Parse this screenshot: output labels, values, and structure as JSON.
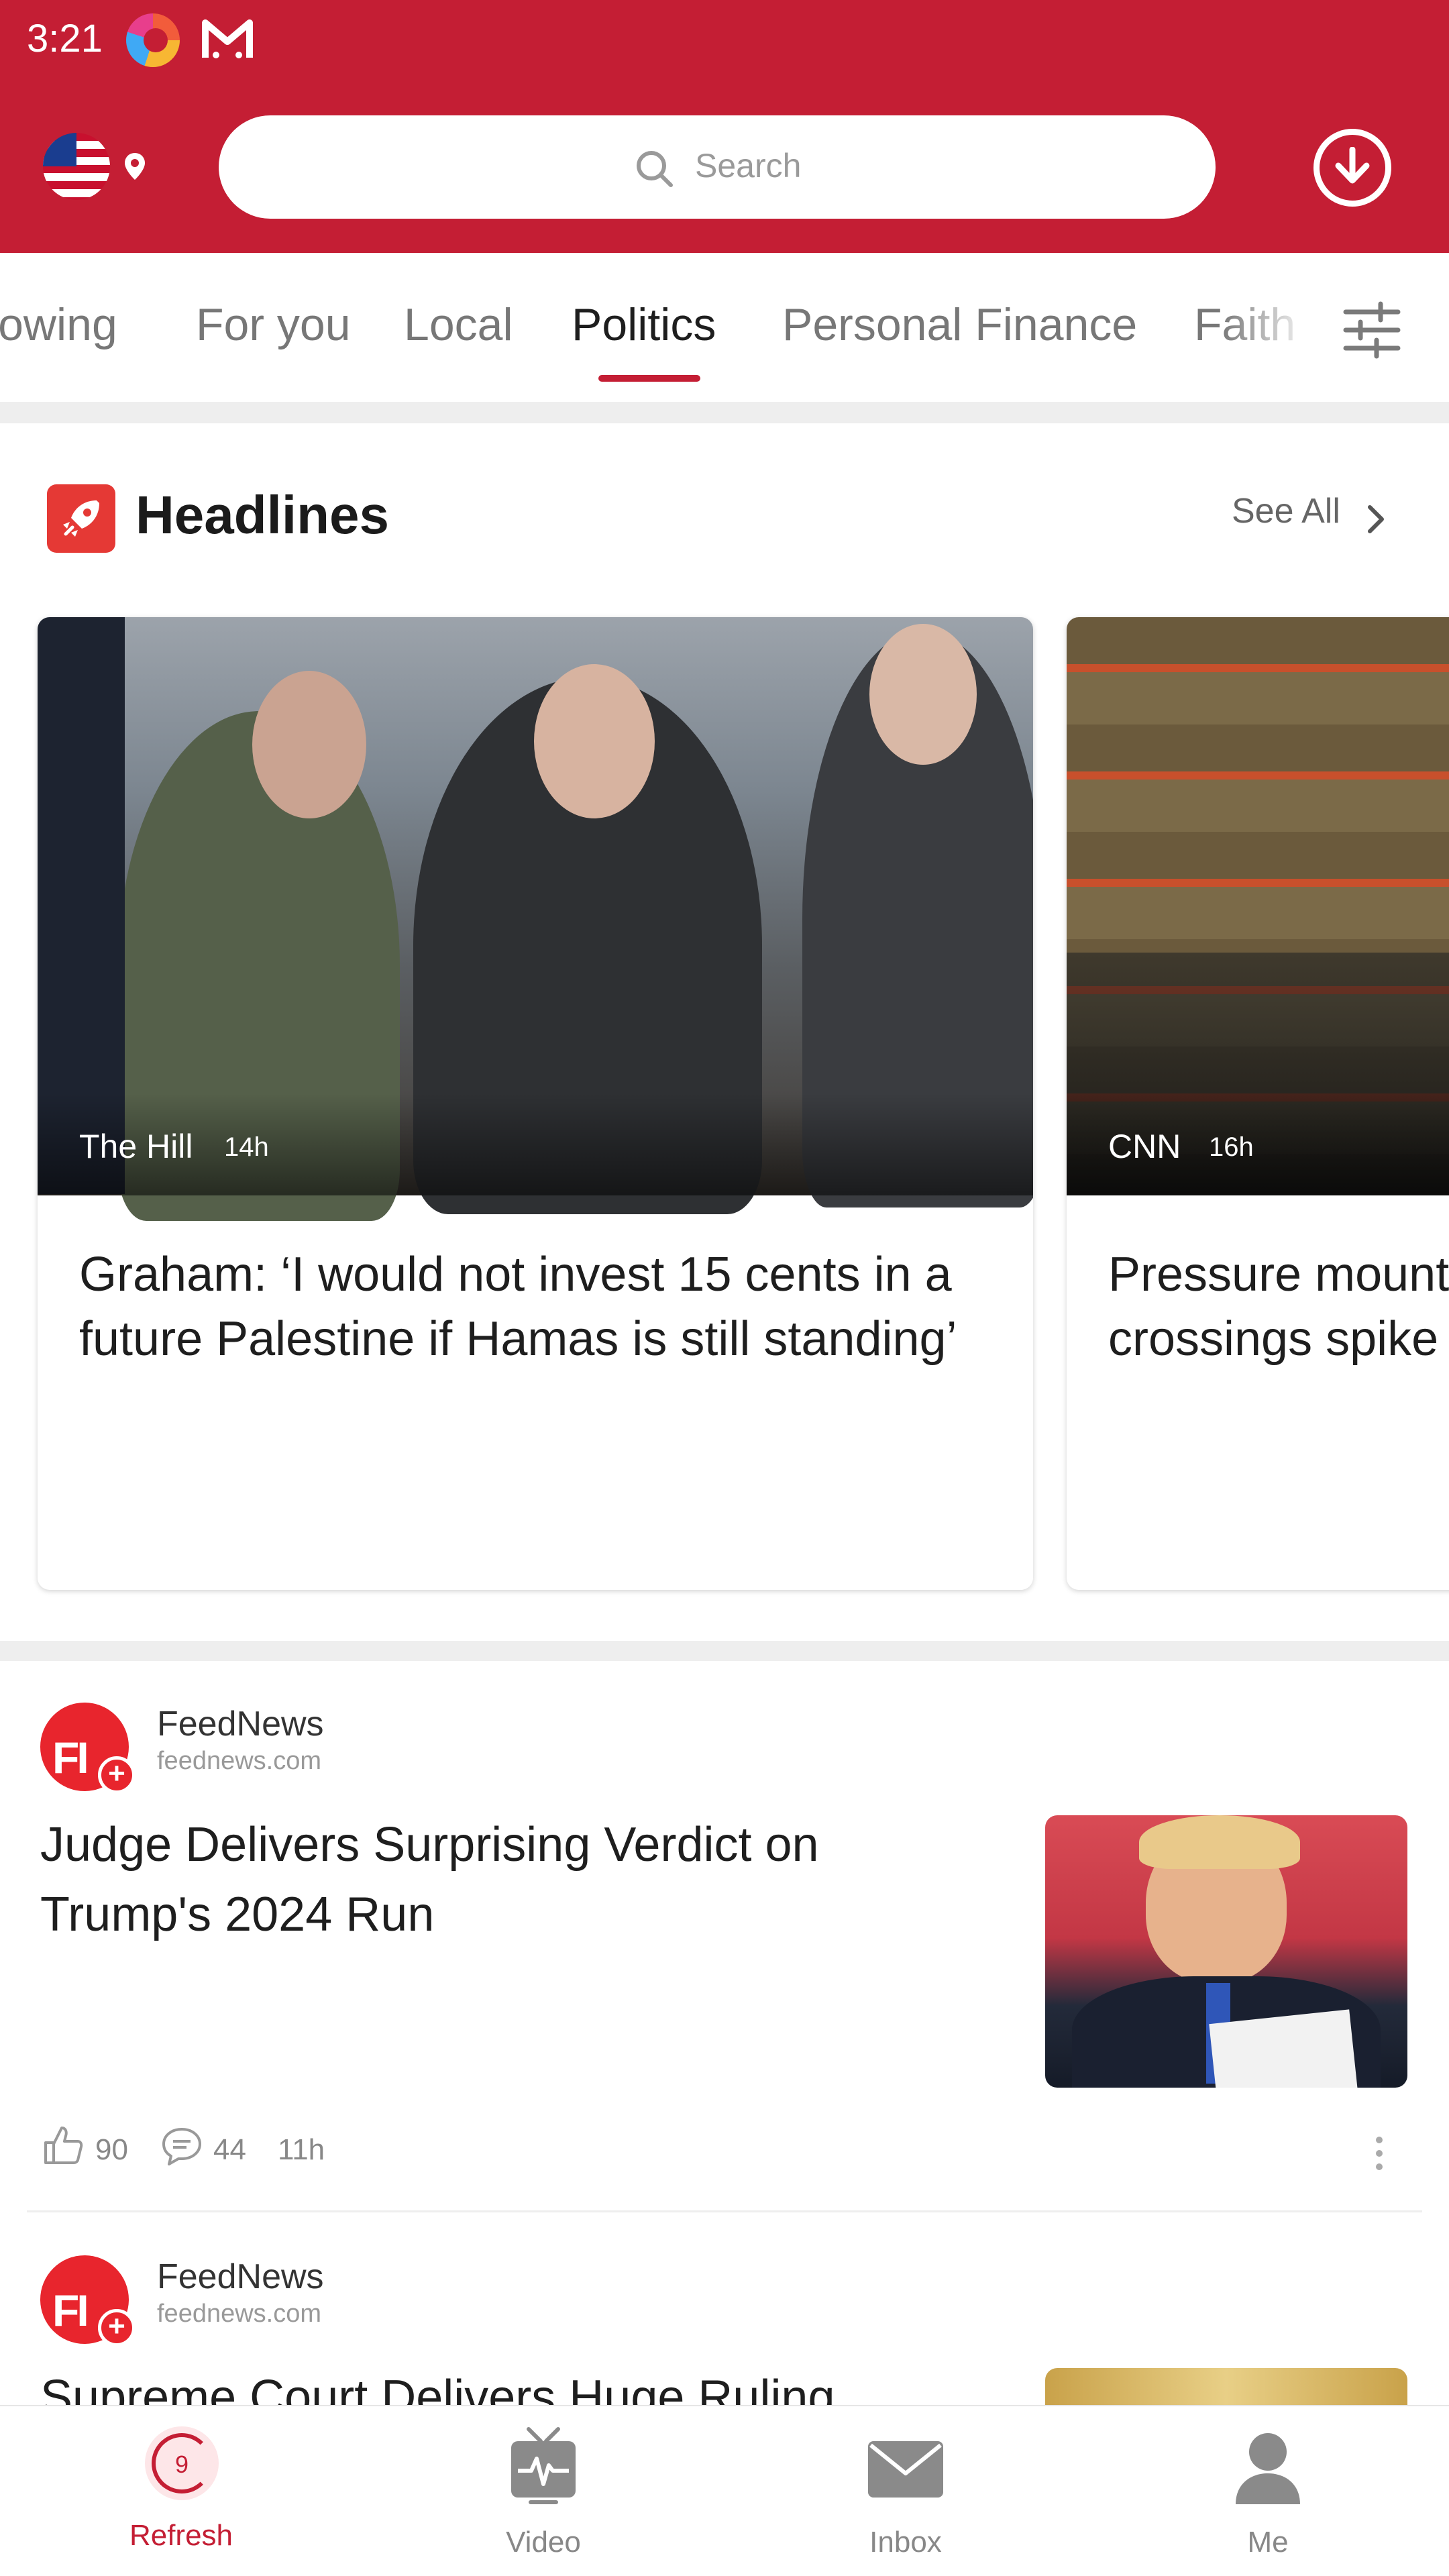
{
  "status_bar": {
    "time": "3:21"
  },
  "search": {
    "placeholder": "Search"
  },
  "tabs": [
    "lowing",
    "For you",
    "Local",
    "Politics",
    "Personal Finance",
    "Faith"
  ],
  "active_tab": "Politics",
  "headlines": {
    "title": "Headlines",
    "see_all": "See All",
    "cards": [
      {
        "source": "The Hill",
        "time": "14h",
        "headline": "Graham: ‘I would not invest 15 cents in a future Palestine if Hamas is still standing’"
      },
      {
        "source": "CNN",
        "time": "16h",
        "headline": "Pressure mount crossings spike"
      }
    ]
  },
  "feed": [
    {
      "publisher": "FeedNews",
      "domain": "feednews.com",
      "logo_text": "FI",
      "headline": "Judge Delivers Surprising Verdict on Trump's 2024 Run",
      "likes": "90",
      "comments": "44",
      "age": "11h"
    },
    {
      "publisher": "FeedNews",
      "domain": "feednews.com",
      "logo_text": "FI",
      "headline": "Supreme Court Delivers Huge Ruling"
    }
  ],
  "bottom_nav": [
    {
      "label": "Refresh",
      "icon": "refresh-icon",
      "badge": "9"
    },
    {
      "label": "Video",
      "icon": "tv-icon"
    },
    {
      "label": "Inbox",
      "icon": "mail-icon"
    },
    {
      "label": "Me",
      "icon": "person-icon"
    }
  ],
  "colors": {
    "brand": "#c41e34",
    "active_text": "#1e1e1e",
    "muted_text": "#777777"
  }
}
